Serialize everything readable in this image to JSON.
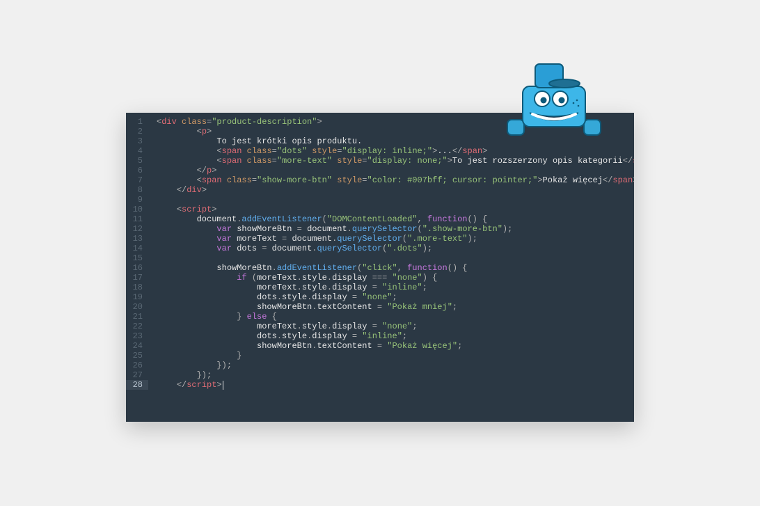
{
  "editor": {
    "line_count": 28,
    "active_line": 28,
    "lines": [
      {
        "n": 1,
        "html": "<span class='punc'>&lt;</span><span class='tag'>div</span> <span class='attr-name'>class</span><span class='punc'>=</span><span class='attr-val'>\"product-description\"</span><span class='punc'>&gt;</span>"
      },
      {
        "n": 2,
        "html": "        <span class='punc'>&lt;</span><span class='tag'>p</span><span class='punc'>&gt;</span>"
      },
      {
        "n": 3,
        "html": "            <span class='txt'>To jest kr&#243;tki opis produktu.</span>"
      },
      {
        "n": 4,
        "html": "            <span class='punc'>&lt;</span><span class='tag'>span</span> <span class='attr-name'>class</span><span class='punc'>=</span><span class='attr-val'>\"dots\"</span> <span class='attr-name'>style</span><span class='punc'>=</span><span class='attr-val'>\"display: inline;\"</span><span class='punc'>&gt;</span><span class='txt'>...</span><span class='punc'>&lt;/</span><span class='tag'>span</span><span class='punc'>&gt;</span>"
      },
      {
        "n": 5,
        "html": "            <span class='punc'>&lt;</span><span class='tag'>span</span> <span class='attr-name'>class</span><span class='punc'>=</span><span class='attr-val'>\"more-text\"</span> <span class='attr-name'>style</span><span class='punc'>=</span><span class='attr-val'>\"display: none;\"</span><span class='punc'>&gt;</span><span class='txt'>To jest rozszerzony opis kategorii</span><span class='punc'>&lt;/</span><span class='tag'>span</span><span class='punc'>&gt;</span>"
      },
      {
        "n": 6,
        "html": "        <span class='punc'>&lt;/</span><span class='tag'>p</span><span class='punc'>&gt;</span>"
      },
      {
        "n": 7,
        "html": "        <span class='punc'>&lt;</span><span class='tag'>span</span> <span class='attr-name'>class</span><span class='punc'>=</span><span class='attr-val'>\"show-more-btn\"</span> <span class='attr-name'>style</span><span class='punc'>=</span><span class='attr-val'>\"color: #007bff; cursor: pointer;\"</span><span class='punc'>&gt;</span><span class='txt'>Poka&#380; wi&#281;cej</span><span class='punc'>&lt;/</span><span class='tag'>span</span><span class='punc'>&gt;</span>"
      },
      {
        "n": 8,
        "html": "    <span class='punc'>&lt;/</span><span class='tag'>div</span><span class='punc'>&gt;</span>"
      },
      {
        "n": 9,
        "html": ""
      },
      {
        "n": 10,
        "html": "    <span class='punc'>&lt;</span><span class='tag'>script</span><span class='punc'>&gt;</span>"
      },
      {
        "n": 11,
        "html": "        <span class='txt'>document</span><span class='punc'>.</span><span class='fn'>addEventListener</span><span class='punc'>(</span><span class='str'>\"DOMContentLoaded\"</span><span class='punc'>,</span> <span class='kw'>function</span><span class='punc'>() {</span>"
      },
      {
        "n": 12,
        "html": "            <span class='kw'>var</span> <span class='txt'>showMoreBtn</span> <span class='punc'>=</span> <span class='txt'>document</span><span class='punc'>.</span><span class='fn'>querySelector</span><span class='punc'>(</span><span class='str'>\".show-more-btn\"</span><span class='punc'>);</span>"
      },
      {
        "n": 13,
        "html": "            <span class='kw'>var</span> <span class='txt'>moreText</span> <span class='punc'>=</span> <span class='txt'>document</span><span class='punc'>.</span><span class='fn'>querySelector</span><span class='punc'>(</span><span class='str'>\".more-text\"</span><span class='punc'>);</span>"
      },
      {
        "n": 14,
        "html": "            <span class='kw'>var</span> <span class='txt'>dots</span> <span class='punc'>=</span> <span class='txt'>document</span><span class='punc'>.</span><span class='fn'>querySelector</span><span class='punc'>(</span><span class='str'>\".dots\"</span><span class='punc'>);</span>"
      },
      {
        "n": 15,
        "html": ""
      },
      {
        "n": 16,
        "html": "            <span class='txt'>showMoreBtn</span><span class='punc'>.</span><span class='fn'>addEventListener</span><span class='punc'>(</span><span class='str'>\"click\"</span><span class='punc'>,</span> <span class='kw'>function</span><span class='punc'>() {</span>"
      },
      {
        "n": 17,
        "html": "                <span class='kw'>if</span> <span class='punc'>(</span><span class='txt'>moreText</span><span class='punc'>.</span><span class='txt'>style</span><span class='punc'>.</span><span class='txt'>display</span> <span class='punc'>===</span> <span class='str'>\"none\"</span><span class='punc'>) {</span>"
      },
      {
        "n": 18,
        "html": "                    <span class='txt'>moreText</span><span class='punc'>.</span><span class='txt'>style</span><span class='punc'>.</span><span class='txt'>display</span> <span class='punc'>=</span> <span class='str'>\"inline\"</span><span class='punc'>;</span>"
      },
      {
        "n": 19,
        "html": "                    <span class='txt'>dots</span><span class='punc'>.</span><span class='txt'>style</span><span class='punc'>.</span><span class='txt'>display</span> <span class='punc'>=</span> <span class='str'>\"none\"</span><span class='punc'>;</span>"
      },
      {
        "n": 20,
        "html": "                    <span class='txt'>showMoreBtn</span><span class='punc'>.</span><span class='txt'>textContent</span> <span class='punc'>=</span> <span class='str'>\"Poka&#380; mniej\"</span><span class='punc'>;</span>"
      },
      {
        "n": 21,
        "html": "                <span class='punc'>}</span> <span class='kw'>else</span> <span class='punc'>{</span>"
      },
      {
        "n": 22,
        "html": "                    <span class='txt'>moreText</span><span class='punc'>.</span><span class='txt'>style</span><span class='punc'>.</span><span class='txt'>display</span> <span class='punc'>=</span> <span class='str'>\"none\"</span><span class='punc'>;</span>"
      },
      {
        "n": 23,
        "html": "                    <span class='txt'>dots</span><span class='punc'>.</span><span class='txt'>style</span><span class='punc'>.</span><span class='txt'>display</span> <span class='punc'>=</span> <span class='str'>\"inline\"</span><span class='punc'>;</span>"
      },
      {
        "n": 24,
        "html": "                    <span class='txt'>showMoreBtn</span><span class='punc'>.</span><span class='txt'>textContent</span> <span class='punc'>=</span> <span class='str'>\"Poka&#380; wi&#281;cej\"</span><span class='punc'>;</span>"
      },
      {
        "n": 25,
        "html": "                <span class='punc'>}</span>"
      },
      {
        "n": 26,
        "html": "            <span class='punc'>});</span>"
      },
      {
        "n": 27,
        "html": "        <span class='punc'>});</span>"
      },
      {
        "n": 28,
        "html": "    <span class='punc'>&lt;/</span><span class='tag'>script</span><span class='punc'>&gt;</span><span class='cursor'></span>"
      }
    ]
  },
  "mascot": {
    "name": "mascot-character"
  }
}
